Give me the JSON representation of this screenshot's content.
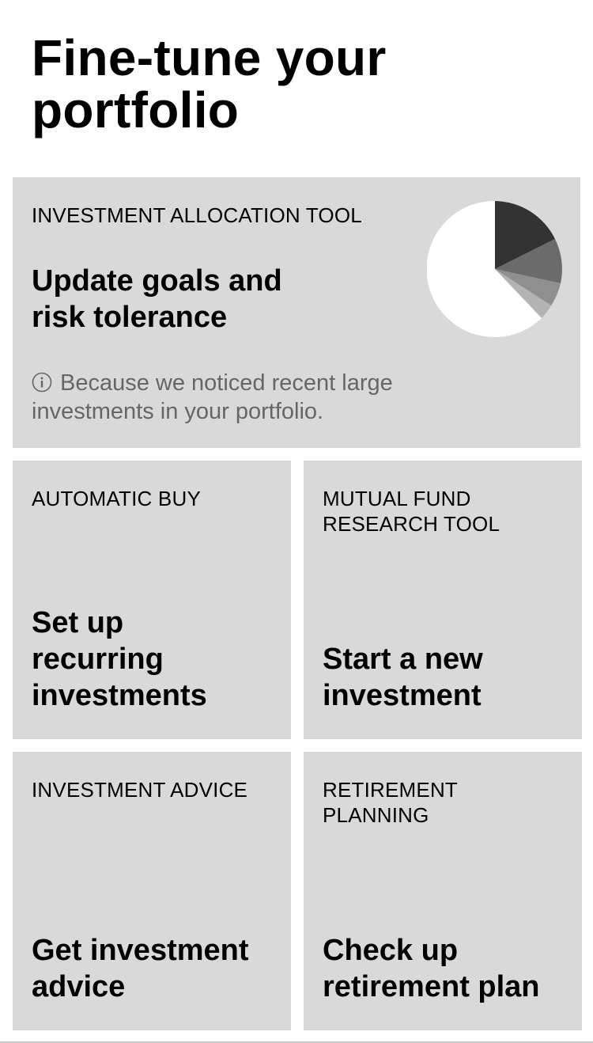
{
  "page": {
    "title_line1": "Fine-tune your",
    "title_line2": "portfolio"
  },
  "featured_card": {
    "eyebrow": "INVESTMENT ALLOCATION TOOL",
    "heading_line1": "Update goals and",
    "heading_line2": "risk tolerance",
    "note_line1": "Because we noticed recent large",
    "note_line2": "investments in your portfolio.",
    "info_icon": "info-circle-icon",
    "pie_chart_icon": "pie-chart-icon"
  },
  "cards": [
    {
      "eyebrow_line1": "AUTOMATIC BUY",
      "eyebrow_line2": "",
      "heading_line1": "Set up",
      "heading_line2": "recurring",
      "heading_line3": "investments"
    },
    {
      "eyebrow_line1": "MUTUAL FUND",
      "eyebrow_line2": "RESEARCH TOOL",
      "heading_line1": "Start a new",
      "heading_line2": "investment",
      "heading_line3": ""
    },
    {
      "eyebrow_line1": "INVESTMENT ADVICE",
      "eyebrow_line2": "",
      "heading_line1": "Get investment",
      "heading_line2": "advice",
      "heading_line3": ""
    },
    {
      "eyebrow_line1": "RETIREMENT",
      "eyebrow_line2": "PLANNING",
      "heading_line1": "Check up",
      "heading_line2": "retirement plan",
      "heading_line3": ""
    }
  ],
  "colors": {
    "card_background": "#d9d9d9",
    "page_background": "#ffffff",
    "note_text": "#666666",
    "pie_slices": [
      "#333333",
      "#6b6b6b",
      "#8f8f8f",
      "#b3b3b3",
      "#ffffff"
    ]
  }
}
